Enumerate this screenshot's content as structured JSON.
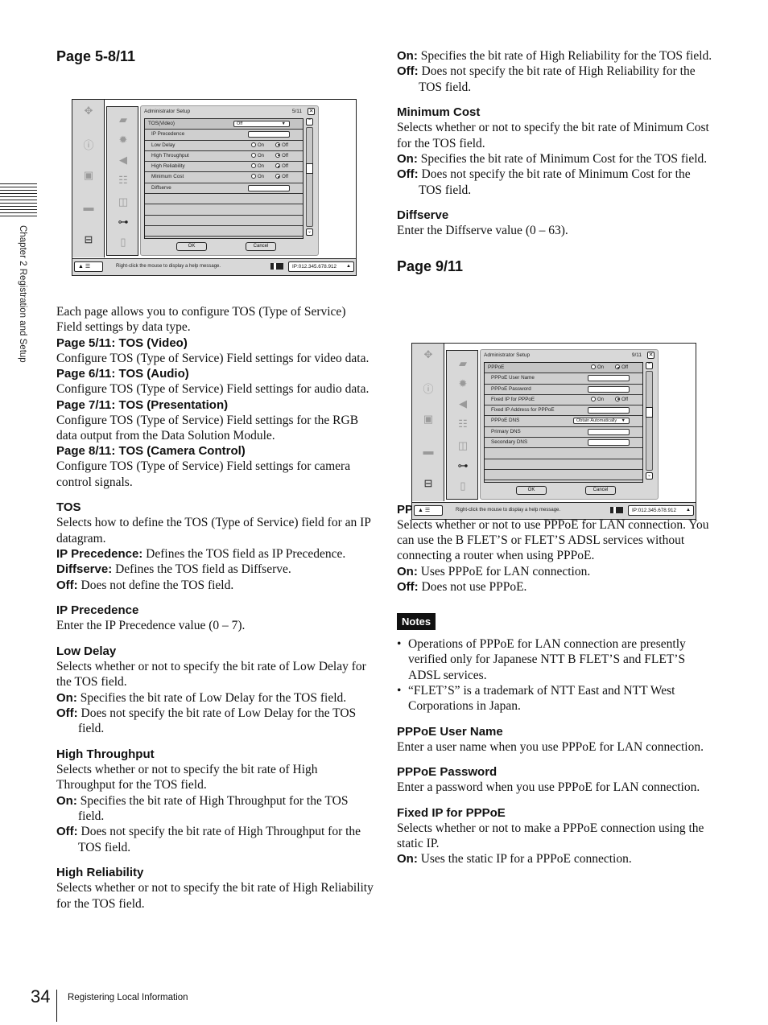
{
  "side_tab": {
    "label": "Chapter 2  Registration and Setup"
  },
  "left": {
    "page_heading": "Page 5-8/11",
    "intro": "Each page allows you to configure TOS (Type of Service) Field settings by data type.",
    "pages": [
      {
        "title": "Page 5/11: TOS (Video)",
        "desc": "Configure TOS (Type of Service) Field settings for video data."
      },
      {
        "title": "Page 6/11: TOS (Audio)",
        "desc": "Configure TOS (Type of Service) Field settings for audio data."
      },
      {
        "title": "Page 7/11: TOS (Presentation)",
        "desc": "Configure TOS (Type of Service) Field settings for the RGB data output from the Data Solution Module."
      },
      {
        "title": "Page 8/11: TOS (Camera Control)",
        "desc": "Configure TOS (Type of Service) Field settings for camera control signals."
      }
    ],
    "tos": {
      "title": "TOS",
      "desc": "Selects how to define the TOS (Type of Service) field for an IP datagram.",
      "opts": [
        {
          "k": "IP Precedence:",
          "v": " Defines the TOS field as IP Precedence."
        },
        {
          "k": "Diffserve:",
          "v": " Defines the TOS field as Diffserve."
        },
        {
          "k": "Off:",
          "v": " Does not define the TOS field."
        }
      ]
    },
    "ip_prec": {
      "title": "IP Precedence",
      "desc": "Enter the IP Precedence value (0 – 7)."
    },
    "low_delay": {
      "title": "Low Delay",
      "desc": "Selects whether or not to specify the bit rate of Low Delay for the TOS field.",
      "on_k": "On:",
      "on_v": " Specifies the bit rate of Low Delay for the TOS field.",
      "off_k": "Off:",
      "off_v": " Does not specify the bit rate of Low Delay for the TOS field."
    },
    "high_thr": {
      "title": "High Throughput",
      "desc": "Selects whether or not to specify the bit rate of High Throughput for the TOS field.",
      "on_k": "On:",
      "on_v": " Specifies the bit rate of High Throughput for the TOS field.",
      "off_k": "Off:",
      "off_v": " Does not specify the bit rate of High Throughput for the TOS field."
    },
    "high_rel": {
      "title": "High Reliability",
      "desc": "Selects whether or not to specify the bit rate of High Reliability for the TOS field."
    }
  },
  "right": {
    "high_rel_on_k": "On:",
    "high_rel_on_v": " Specifies the bit rate of High Reliability for the TOS field.",
    "high_rel_off_k": "Off:",
    "high_rel_off_v": " Does not specify the bit rate of High Reliability for the TOS field.",
    "min_cost": {
      "title": "Minimum Cost",
      "desc": "Selects whether or not to specify the bit rate of Minimum Cost for the TOS field.",
      "on_k": "On:",
      "on_v": " Specifies the bit rate of Minimum Cost for the TOS field.",
      "off_k": "Off:",
      "off_v": " Does not specify the bit rate of Minimum Cost for the TOS field."
    },
    "diffserve": {
      "title": "Diffserve",
      "desc": "Enter the Diffserve value (0 – 63)."
    },
    "page_heading": "Page 9/11",
    "pppoe": {
      "title": "PPPoE",
      "desc": "Selects whether or not to use PPPoE for LAN connection. You can use the B FLET’S or FLET’S ADSL services without connecting a router when using PPPoE.",
      "on_k": "On:",
      "on_v": " Uses PPPoE for LAN connection.",
      "off_k": "Off:",
      "off_v": " Does not use PPPoE."
    },
    "notes_label": "Notes",
    "notes": [
      "Operations of PPPoE for LAN connection are presently verified only for Japanese NTT B FLET’S and FLET’S ADSL services.",
      "“FLET’S” is a trademark of NTT East and NTT West Corporations in Japan."
    ],
    "user_name": {
      "title": "PPPoE User Name",
      "desc": "Enter a user name when you use PPPoE for LAN connection."
    },
    "password": {
      "title": "PPPoE Password",
      "desc": "Enter a password when you use PPPoE for LAN connection."
    },
    "fixed_ip": {
      "title": "Fixed IP for PPPoE",
      "desc": "Selects whether or not to make a PPPoE connection using the static IP.",
      "on_k": "On:",
      "on_v": " Uses the static IP for a PPPoE connection."
    }
  },
  "screen1": {
    "title": "Administrator Setup",
    "page": "5/11",
    "rows": [
      {
        "label": "TOS(Video)",
        "type": "select",
        "value": "Off"
      },
      {
        "label": "IP Precedence",
        "type": "field"
      },
      {
        "label": "Low Delay",
        "type": "radio"
      },
      {
        "label": "High Throughput",
        "type": "radio"
      },
      {
        "label": "High Reliability",
        "type": "radio"
      },
      {
        "label": "Minimum Cost",
        "type": "radio"
      },
      {
        "label": "Diffserve",
        "type": "field"
      }
    ],
    "on": "On",
    "off": "Off",
    "ok": "OK",
    "cancel": "Cancel",
    "help": "Right-click the mouse to display a help message.",
    "ip": "IP:012.345.678.912"
  },
  "screen2": {
    "title": "Administrator Setup",
    "page": "9/11",
    "rows": [
      {
        "label": "PPPoE",
        "type": "radio"
      },
      {
        "label": "PPPoE User Name",
        "type": "field"
      },
      {
        "label": "PPPoE Password",
        "type": "field"
      },
      {
        "label": "Fixed IP for PPPoE",
        "type": "radio"
      },
      {
        "label": "Fixed IP Address for PPPoE",
        "type": "field"
      },
      {
        "label": "PPPoE DNS",
        "type": "select",
        "value": "Obtain Automatically"
      },
      {
        "label": "Primary DNS",
        "type": "field"
      },
      {
        "label": "Secondary DNS",
        "type": "field"
      }
    ],
    "on": "On",
    "off": "Off",
    "ok": "OK",
    "cancel": "Cancel",
    "help": "Right-click the mouse to display a help message.",
    "ip": "IP:012.345.678.912"
  },
  "footer": {
    "page_number": "34",
    "section": "Registering Local Information"
  }
}
